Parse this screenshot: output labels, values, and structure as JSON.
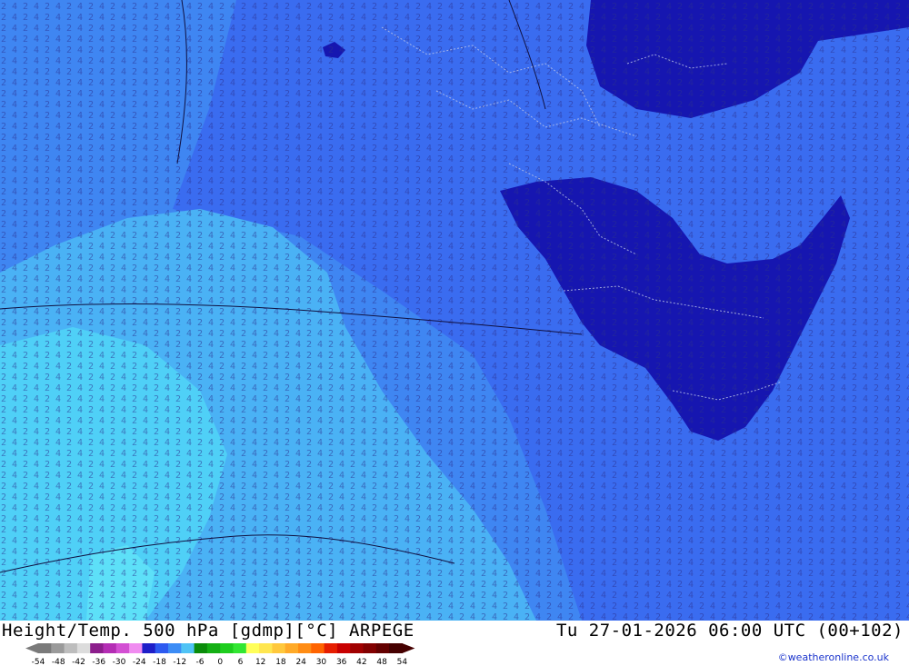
{
  "map": {
    "title_left": "Height/Temp. 500 hPa [gdmp][°C] ARPEGE",
    "title_right": "Tu 27-01-2026 06:00 UTC (00+102)",
    "credit": "©weatheronline.co.uk",
    "colors": {
      "field_mid": "#3a6cf0",
      "field_dark": "#1616b0",
      "field_light": "#4ab2f5",
      "field_cyan": "#4fd0f7",
      "contour": "#101040",
      "border": "#c0c8e8"
    }
  },
  "legend": {
    "ticks": [
      "-54",
      "-48",
      "-42",
      "-36",
      "-30",
      "-24",
      "-18",
      "-12",
      "-6",
      "0",
      "6",
      "12",
      "18",
      "24",
      "30",
      "36",
      "42",
      "48",
      "54"
    ],
    "colors": [
      "#7a7a7a",
      "#9a9a9a",
      "#bdbdbd",
      "#dcdcdc",
      "#8c1e8c",
      "#b42db4",
      "#d34fd3",
      "#f08cf0",
      "#1e1ec8",
      "#2d5af0",
      "#3c8cf5",
      "#50c3f5",
      "#0a8c0a",
      "#14af14",
      "#1ecd1e",
      "#32e632",
      "#ffff5a",
      "#ffe650",
      "#ffc83c",
      "#ffaa28",
      "#ff8c14",
      "#ff6400",
      "#e61e00",
      "#c80000",
      "#a00000",
      "#820000",
      "#640000",
      "#460000"
    ]
  }
}
